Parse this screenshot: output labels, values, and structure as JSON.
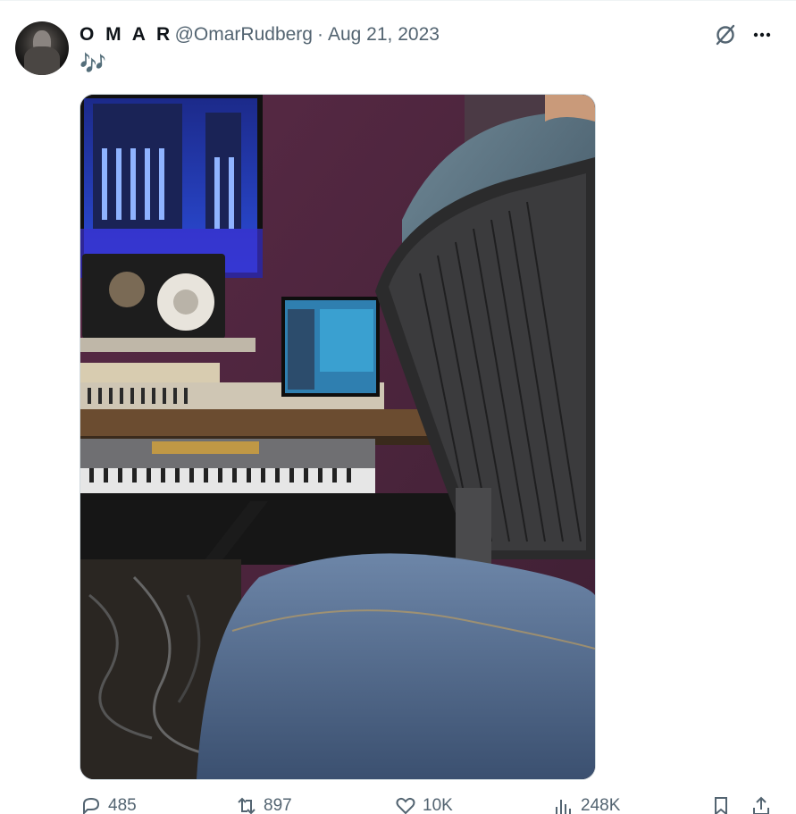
{
  "tweet": {
    "display_name": "O M A R",
    "handle": "@OmarRudberg",
    "separator": "·",
    "date": "Aug 21, 2023",
    "text": "🎶"
  },
  "media": {
    "icon": "photo-studio-image"
  },
  "actions": {
    "replies": "485",
    "retweets": "897",
    "likes": "10K",
    "views": "248K"
  },
  "colors": {
    "accent": "#1d9bf0",
    "secondary_text": "#536471"
  }
}
